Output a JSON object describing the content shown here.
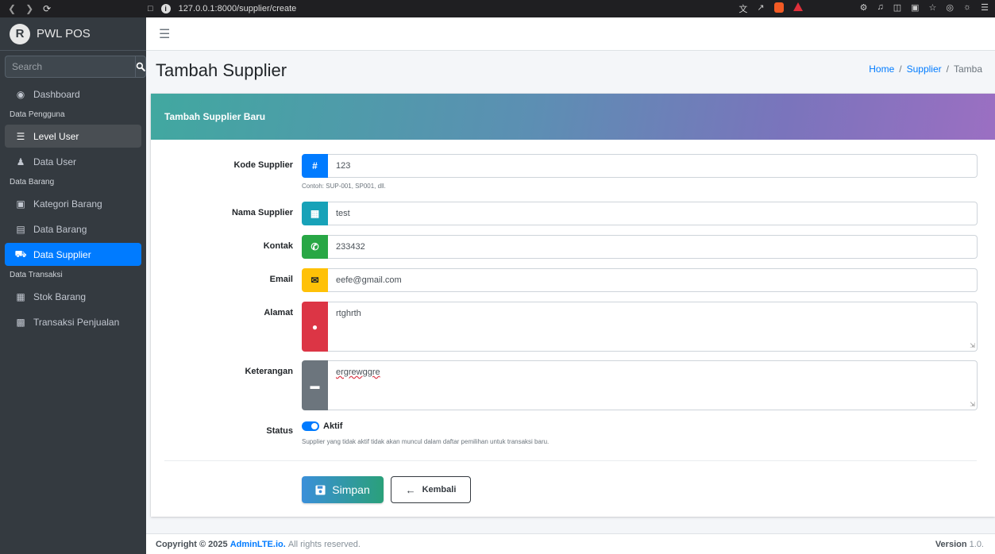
{
  "browser": {
    "url": "127.0.0.1:8000/supplier/create"
  },
  "app": {
    "name": "PWL POS",
    "logo_letter": "R"
  },
  "search": {
    "placeholder": "Search"
  },
  "sidebar": {
    "dashboard": "Dashboard",
    "header_pengguna": "Data Pengguna",
    "level_user": "Level User",
    "data_user": "Data User",
    "header_barang": "Data Barang",
    "kategori_barang": "Kategori Barang",
    "data_barang": "Data Barang",
    "data_supplier": "Data Supplier",
    "header_transaksi": "Data Transaksi",
    "stok_barang": "Stok Barang",
    "transaksi_penjualan": "Transaksi Penjualan"
  },
  "page": {
    "title": "Tambah Supplier"
  },
  "breadcrumb": {
    "home": "Home",
    "supplier": "Supplier",
    "current": "Tamba"
  },
  "card": {
    "title": "Tambah Supplier Baru"
  },
  "form": {
    "kode": {
      "label": "Kode Supplier",
      "value": "123",
      "help": "Contoh: SUP-001, SP001, dll."
    },
    "nama": {
      "label": "Nama Supplier",
      "value": "test"
    },
    "kontak": {
      "label": "Kontak",
      "value": "233432"
    },
    "email": {
      "label": "Email",
      "value": "eefe@gmail.com"
    },
    "alamat": {
      "label": "Alamat",
      "value": "rtghrth"
    },
    "keterangan": {
      "label": "Keterangan",
      "value": "ergrewggre"
    },
    "status": {
      "label": "Status",
      "toggle_label": "Aktif",
      "checked": true,
      "help": "Supplier yang tidak aktif tidak akan muncul dalam daftar pemilihan untuk transaksi baru."
    }
  },
  "buttons": {
    "save": "Simpan",
    "back": "Kembali"
  },
  "footer": {
    "copyright": "Copyright © 2025",
    "brand": "AdminLTE.io.",
    "rights": "All rights reserved.",
    "version_label": "Version",
    "version": "1.0."
  },
  "colors": {
    "primary": "#007bff",
    "info": "#17a2b8",
    "success": "#28a745",
    "warning": "#ffc107",
    "danger": "#dc3545",
    "secondary": "#6c757d",
    "sidebar": "#343a40"
  }
}
